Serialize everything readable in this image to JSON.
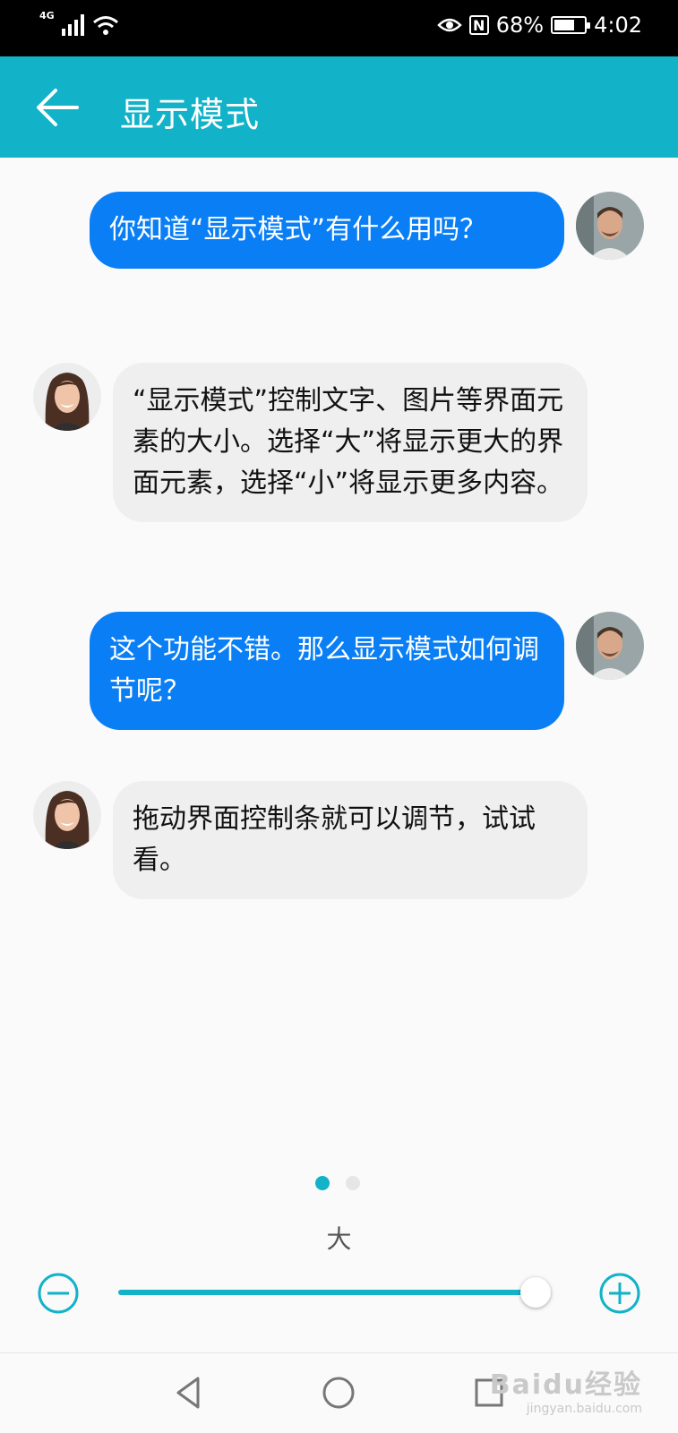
{
  "status_bar": {
    "network": "4G",
    "battery": "68%",
    "battery_level": 0.68,
    "nfc_label": "N",
    "time": "4:02"
  },
  "app_bar": {
    "back_icon": "arrow-left-icon",
    "title": "显示模式"
  },
  "messages": [
    {
      "side": "right",
      "text": "你知道“显示模式”有什么用吗？"
    },
    {
      "side": "left",
      "text": "“显示模式”控制文字、图片等界面元素的大小。选择“大”将显示更大的界面元素，选择“小”将显示更多内容。"
    },
    {
      "side": "right",
      "text": "这个功能不错。那么显示模式如何调节呢？"
    },
    {
      "side": "left",
      "text": "拖动界面控制条就可以调节，试试看。"
    }
  ],
  "pager": {
    "pages": 2,
    "active": 1
  },
  "size_control": {
    "label": "大",
    "level": 1.0,
    "decrease_icon": "minus-circle-icon",
    "increase_icon": "plus-circle-icon"
  },
  "nav_bar": {
    "back_icon": "triangle-back-icon",
    "home_icon": "circle-home-icon",
    "recents_icon": "square-recents-icon"
  },
  "watermark": {
    "main": "Baidu经验",
    "sub": "jingyan.baidu.com"
  },
  "colors": {
    "accent": "#12b2c8",
    "bubble_right": "#0a7ff5",
    "bubble_left": "#efefef"
  }
}
